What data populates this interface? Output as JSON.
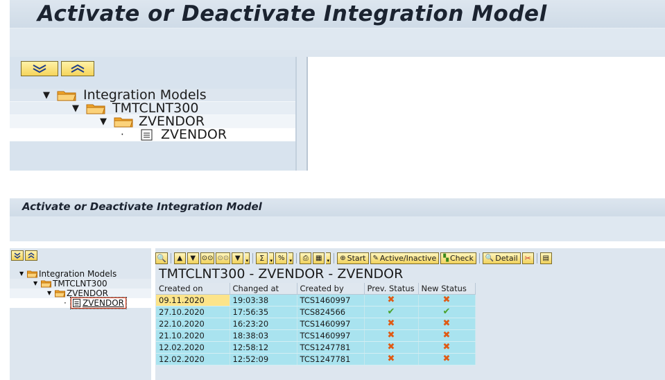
{
  "top": {
    "title": "Activate or Deactivate Integration Model",
    "tree_buttons": [
      "expand-all-icon",
      "collapse-all-icon"
    ],
    "nodes": [
      {
        "label": "Integration Models",
        "type": "folder",
        "expanded": true
      },
      {
        "label": "TMTCLNT300",
        "type": "folder",
        "expanded": true
      },
      {
        "label": "ZVENDOR",
        "type": "folder",
        "expanded": true
      },
      {
        "label": "ZVENDOR",
        "type": "document"
      }
    ]
  },
  "bottom": {
    "title": "Activate or Deactivate Integration Model",
    "tree_buttons": [
      "expand-all-icon",
      "collapse-all-icon"
    ],
    "nodes": [
      {
        "label": "Integration Models",
        "type": "folder"
      },
      {
        "label": "TMTCLNT300",
        "type": "folder"
      },
      {
        "label": "ZVENDOR",
        "type": "folder"
      },
      {
        "label": "ZVENDOR",
        "type": "document",
        "selected": true
      }
    ],
    "toolbar": {
      "start_label": "Start",
      "active_inactive_label": "Active/Inactive",
      "check_label": "Check",
      "detail_label": "Detail"
    },
    "grid_title": "TMTCLNT300 - ZVENDOR - ZVENDOR",
    "columns": [
      "Created on",
      "Changed at",
      "Created by",
      "Prev. Status",
      "New Status"
    ],
    "rows": [
      {
        "created_on": "09.11.2020",
        "changed_at": "19:03:38",
        "created_by": "TCS1460997",
        "prev_status": "inactive",
        "new_status": "inactive"
      },
      {
        "created_on": "27.10.2020",
        "changed_at": "17:56:35",
        "created_by": "TCS824566",
        "prev_status": "active",
        "new_status": "active"
      },
      {
        "created_on": "22.10.2020",
        "changed_at": "16:23:20",
        "created_by": "TCS1460997",
        "prev_status": "inactive",
        "new_status": "inactive"
      },
      {
        "created_on": "21.10.2020",
        "changed_at": "18:38:03",
        "created_by": "TCS1460997",
        "prev_status": "inactive",
        "new_status": "inactive"
      },
      {
        "created_on": "12.02.2020",
        "changed_at": "12:58:12",
        "created_by": "TCS1247781",
        "prev_status": "inactive",
        "new_status": "inactive"
      },
      {
        "created_on": "12.02.2020",
        "changed_at": "12:52:09",
        "created_by": "TCS1247781",
        "prev_status": "inactive",
        "new_status": "inactive"
      }
    ],
    "colors": {
      "row": "#a9e3ef",
      "selected_cell": "#fce48a",
      "cross": "#e05a14",
      "check": "#4aa12c"
    }
  }
}
